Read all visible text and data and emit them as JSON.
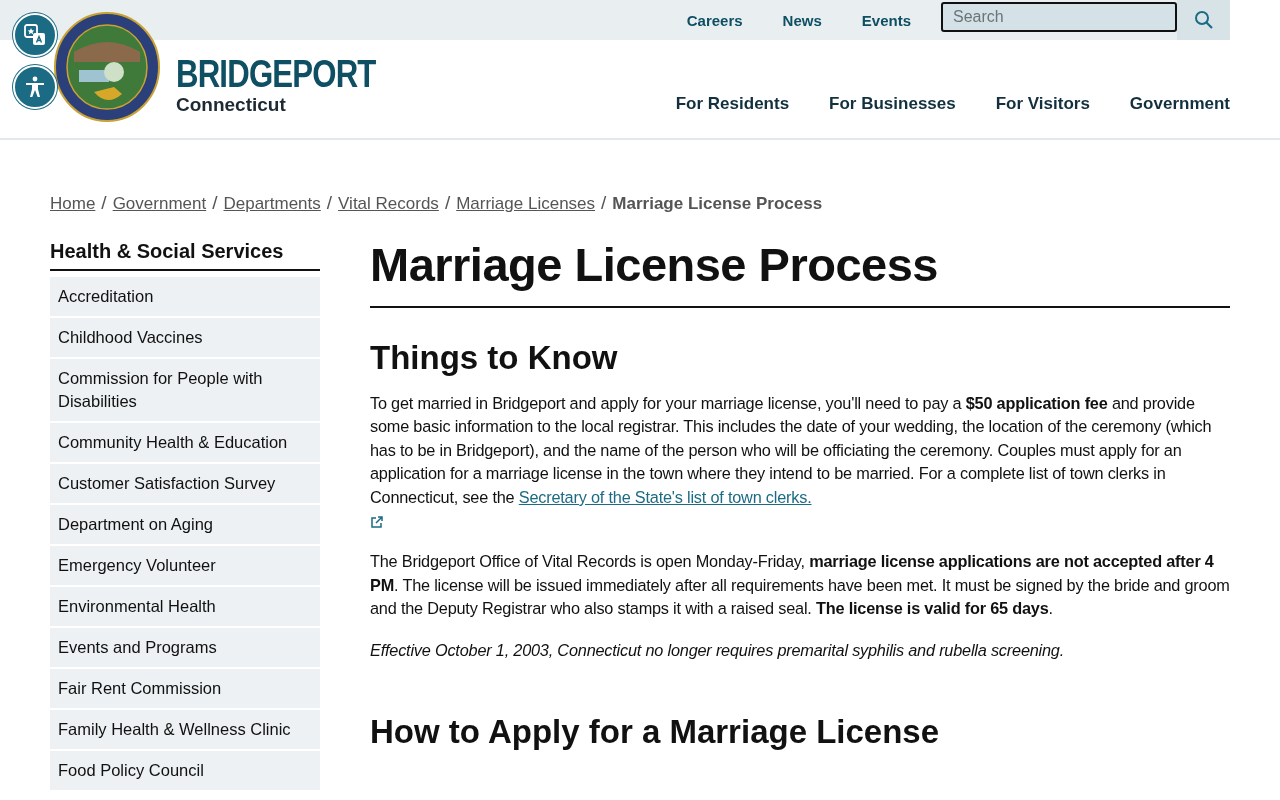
{
  "top_bar": {
    "links": [
      "Careers",
      "News",
      "Events"
    ],
    "search": {
      "placeholder": "Search"
    }
  },
  "header": {
    "city": "BRIDGEPORT",
    "state": "Connecticut",
    "nav": [
      "For Residents",
      "For Businesses",
      "For Visitors",
      "Government"
    ]
  },
  "breadcrumb": [
    {
      "label": "Home",
      "current": false,
      "separator": "/"
    },
    {
      "label": "Government",
      "current": false,
      "separator": "/"
    },
    {
      "label": "Departments",
      "current": false,
      "separator": "/"
    },
    {
      "label": "Vital Records",
      "current": false,
      "separator": "/"
    },
    {
      "label": "Marriage Licenses",
      "current": false,
      "separator": "/"
    },
    {
      "label": "Marriage License Process",
      "current": true
    }
  ],
  "sidebar": {
    "title": "Health & Social Services",
    "items": [
      "Accreditation",
      "Childhood Vaccines",
      "Commission for People with Disabilities",
      "Community Health & Education",
      "Customer Satisfaction Survey",
      "Department on Aging",
      "Emergency Volunteer",
      "Environmental Health",
      "Events and Programs",
      "Fair Rent Commission",
      "Family Health & Wellness Clinic",
      "Food Policy Council"
    ]
  },
  "content": {
    "title": "Marriage License Process",
    "sections": [
      {
        "heading": "Things to Know",
        "paragraphs": [
          {
            "kind": "link",
            "text": "To get married in Bridgeport and apply for your marriage license, you'll need to pay a **$50 application fee** and provide some basic information to the local registrar. This includes the date of your wedding, the location of the ceremony (which has to be in Bridgeport), and the name of the person who will be officiating the ceremony. Couples must apply for an application for a marriage license in the town where they intend to be married. For a complete list of town clerks in Connecticut, see the",
            "link": "Secretary of the State's list of town clerks."
          },
          {
            "kind": "plain",
            "text": "The Bridgeport Office of Vital Records is open Monday-Friday, **marriage license applications are not accepted after 4 PM**. The license will be issued immediately after all requirements have been met. It must be signed by the bride and groom and the Deputy Registrar who also stamps it with a raised seal. **The license is valid for 65 days**."
          },
          {
            "kind": "note",
            "text": "Effective October 1, 2003, Connecticut no longer requires premarital syphilis and rubella screening."
          }
        ]
      },
      {
        "heading": "How to Apply for a Marriage License"
      }
    ]
  }
}
